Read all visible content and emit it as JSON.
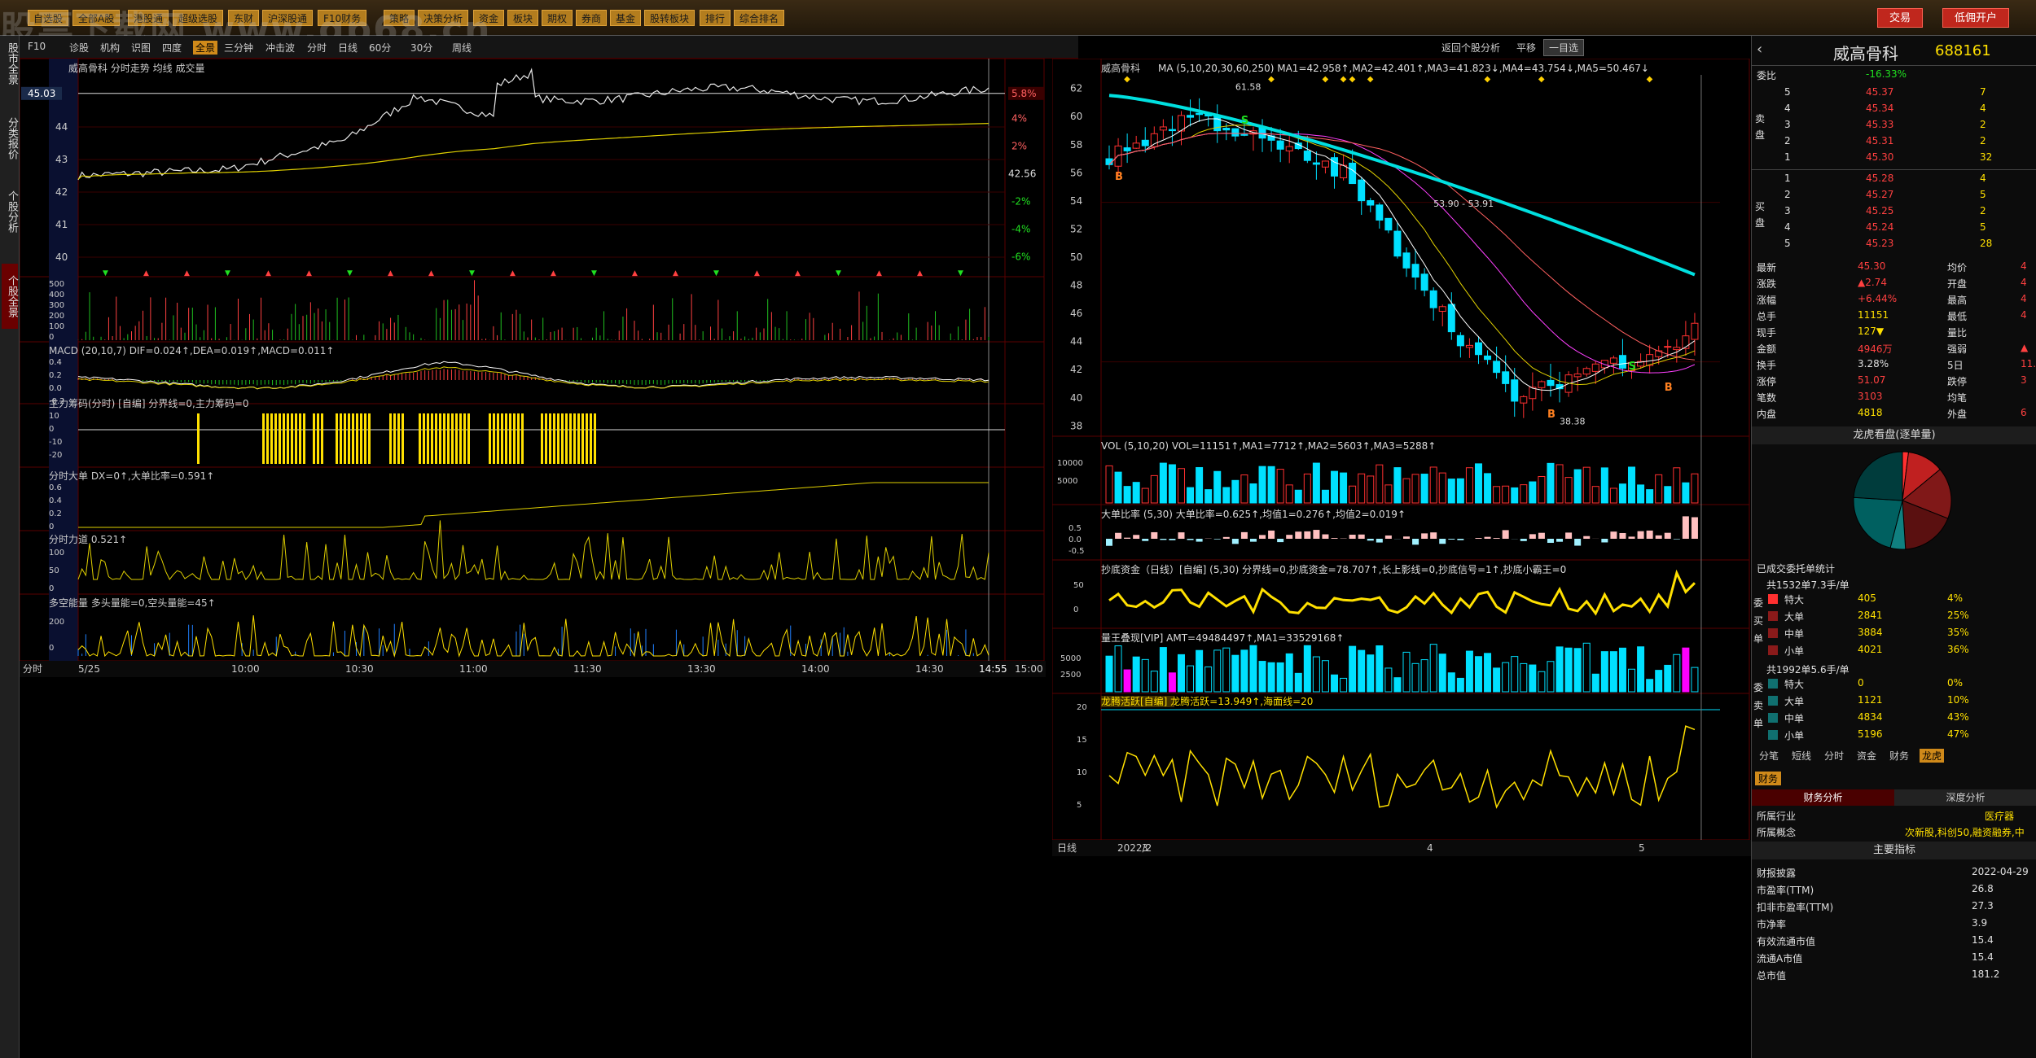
{
  "toolbar": {
    "buttons": [
      "自选股",
      "全部A股",
      "港股通",
      "超级选股",
      "东财",
      "沪深股通",
      "F10财务",
      "策略",
      "决策分析",
      "资金",
      "板块",
      "期权",
      "券商",
      "基金",
      "股转板块",
      "排行",
      "综合排名"
    ],
    "trade_button": "交易",
    "open_account_button": "低佣开户",
    "watermark": "股票下载网 www.gp68.cn"
  },
  "left_tabs": [
    "股市全景",
    "分类报价",
    "个股分析",
    "个股全景"
  ],
  "subbar": {
    "items": [
      "F10",
      "诊股",
      "机构",
      "识图",
      "四度",
      "全景",
      "三分钟",
      "冲击波",
      "分时",
      "日线",
      "60分",
      "30分",
      "周线"
    ],
    "active": "全景",
    "right_items": [
      "返回个股分析",
      "平移",
      "一目选"
    ]
  },
  "intraday": {
    "title": "威高骨科 分时走势 均线 成交量",
    "price_label": "45.03",
    "pct_label": "5.8%",
    "ref_price": "42.56",
    "y_ticks": [
      "44",
      "43",
      "42",
      "41",
      "40"
    ],
    "pct_ticks": [
      "4%",
      "2%",
      "-2%",
      "-4%",
      "-6%"
    ],
    "vol_ticks": [
      "500",
      "400",
      "300",
      "200",
      "100",
      "0"
    ],
    "macd_title": "MACD (20,10,7) DIF=0.024↑,DEA=0.019↑,MACD=0.011↑",
    "macd_ticks": [
      "0.4",
      "0.2",
      "0.0",
      "-0.2"
    ],
    "chip_title": "主力筹码(分时) [自编] 分界线=0,主力筹码=0",
    "chip_ticks": [
      "10",
      "0",
      "-10",
      "-20"
    ],
    "bigorder_title": "分时大单 DX=0↑,大单比率=0.591↑",
    "bigorder_ticks": [
      "0.6",
      "0.4",
      "0.2",
      "0"
    ],
    "force_title": "分时力道 0.521↑",
    "force_ticks": [
      "100",
      "50",
      "0"
    ],
    "energy_title": "多空能量 多头量能=0,空头量能=45↑",
    "energy_ticks": [
      "200",
      "0"
    ],
    "time_labels": [
      "5/25",
      "10:00",
      "10:30",
      "11:00",
      "11:30",
      "13:30",
      "14:00",
      "14:30",
      "14:55",
      "15:00"
    ],
    "bottom_label": "分时"
  },
  "daily": {
    "title": "威高骨科",
    "ma_title": "MA (5,10,20,30,60,250) MA1=42.958↑,MA2=42.401↑,MA3=41.823↓,MA4=43.754↓,MA5=50.467↓",
    "y_ticks": [
      "62",
      "60",
      "58",
      "56",
      "54",
      "52",
      "50",
      "48",
      "46",
      "44",
      "42",
      "40",
      "38"
    ],
    "high_label": "61.58",
    "range_label": "53.90 - 53.91",
    "low_label": "38.38",
    "vol_title": "VOL (5,10,20) VOL=11151↑,MA1=7712↑,MA2=5603↑,MA3=5288↑",
    "vol_ticks": [
      "10000",
      "5000"
    ],
    "big_ratio_title": "大单比率 (5,30) 大单比率=0.625↑,均值1=0.276↑,均值2=0.019↑",
    "big_ratio_ticks": [
      "0.5",
      "0.0",
      "-0.5"
    ],
    "bottom_fund_title": "抄底资金（日线）[自编] (5,30) 分界线=0,抄底资金=78.707↑,长上影线=0,抄底信号=1↑,抄底小霸王=0",
    "bottom_fund_ticks": [
      "50",
      "0"
    ],
    "amount_title": "量王叠现[VIP] AMT=49484497↑,MA1=33529168↑",
    "amount_ticks": [
      "5000",
      "2500"
    ],
    "active_title": "龙腾活跃[自编] 龙腾活跃=13.949↑,海面线=20",
    "active_ticks": [
      "20",
      "15",
      "10",
      "5"
    ],
    "date_labels": [
      "2022/2",
      "3",
      "4",
      "5"
    ],
    "bottom_label": "日线"
  },
  "quote": {
    "name": "威高骨科",
    "code": "688161",
    "ratio_label": "委比",
    "ratio_value": "-16.33%",
    "asks": [
      [
        "5",
        "45.37",
        "7"
      ],
      [
        "4",
        "45.34",
        "4"
      ],
      [
        "3",
        "45.33",
        "2"
      ],
      [
        "2",
        "45.31",
        "2"
      ],
      [
        "1",
        "45.30",
        "32"
      ]
    ],
    "bids": [
      [
        "1",
        "45.28",
        "4"
      ],
      [
        "2",
        "45.27",
        "5"
      ],
      [
        "3",
        "45.25",
        "2"
      ],
      [
        "4",
        "45.24",
        "5"
      ],
      [
        "5",
        "45.23",
        "28"
      ]
    ],
    "ask_side_label": "卖盘",
    "bid_side_label": "买盘",
    "stats": [
      [
        "最新",
        "45.30",
        "均价",
        "4"
      ],
      [
        "涨跌",
        "▲2.74",
        "开盘",
        "4"
      ],
      [
        "涨幅",
        "+6.44%",
        "最高",
        "4"
      ],
      [
        "总手",
        "11151",
        "最低",
        "4"
      ],
      [
        "现手",
        "127▼",
        "量比",
        ""
      ],
      [
        "金额",
        "4946万",
        "强弱",
        "▲"
      ],
      [
        "换手",
        "3.28%",
        "5日",
        "11."
      ],
      [
        "涨停",
        "51.07",
        "跌停",
        "3"
      ],
      [
        "笔数",
        "3103",
        "均笔",
        ""
      ],
      [
        "内盘",
        "4818",
        "外盘",
        "6"
      ]
    ],
    "pie_title": "龙虎看盘(逐单量)",
    "commission_title": "已成交委托单统计",
    "buy_summary": "共1532单7.3手/单",
    "sell_summary": "共1992单5.6手/单",
    "buy_rows": [
      [
        "特大",
        "405",
        "4%"
      ],
      [
        "大单",
        "2841",
        "25%"
      ],
      [
        "中单",
        "3884",
        "35%"
      ],
      [
        "小单",
        "4021",
        "36%"
      ]
    ],
    "sell_rows": [
      [
        "特大",
        "0",
        "0%"
      ],
      [
        "大单",
        "1121",
        "10%"
      ],
      [
        "中单",
        "4834",
        "43%"
      ],
      [
        "小单",
        "5196",
        "47%"
      ]
    ],
    "buy_side_label": "委买单",
    "sell_side_label": "委卖单",
    "tabs": [
      "分笔",
      "短线",
      "分时",
      "资金",
      "财务",
      "龙虎"
    ],
    "active_tab": "龙虎",
    "finance_tab": "财务",
    "sub_tabs": [
      "财务分析",
      "深度分析"
    ],
    "industry_label": "所属行业",
    "industry_value": "医疗器",
    "concept_label": "所属概念",
    "concept_value": "次新股,科创50,融资融券,中",
    "main_index_title": "主要指标",
    "fin_rows": [
      [
        "财报披露",
        "2022-04-29"
      ],
      [
        "市盈率(TTM)",
        "26.8"
      ],
      [
        "扣非市盈率(TTM)",
        "27.3"
      ],
      [
        "市净率",
        "3.9"
      ],
      [
        "有效流通市值",
        "15.4"
      ],
      [
        "流通A市值",
        "15.4"
      ],
      [
        "总市值",
        "181.2"
      ]
    ]
  },
  "colors": {
    "up": "#ff3030",
    "down": "#00e0ff",
    "ma": "#ffe000",
    "grid": "#5a0000"
  }
}
